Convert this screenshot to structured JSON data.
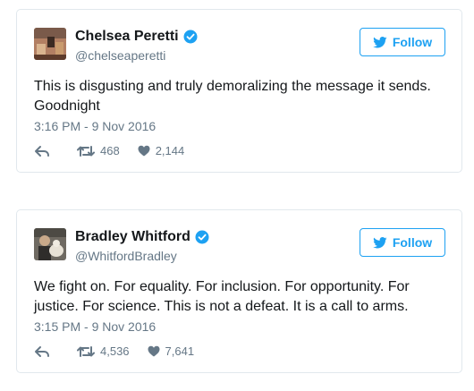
{
  "tweets": [
    {
      "name": "Chelsea Peretti",
      "handle": "@chelseaperetti",
      "follow_label": "Follow",
      "text": "This is disgusting and truly demoralizing the message it sends. Goodnight",
      "timestamp": "3:16 PM - 9 Nov 2016",
      "retweets": "468",
      "likes": "2,144"
    },
    {
      "name": "Bradley Whitford",
      "handle": "@WhitfordBradley",
      "follow_label": "Follow",
      "text": "We fight on. For equality. For inclusion. For opportunity. For justice. For science. This is not a defeat. It is a call to arms.",
      "timestamp": "3:15 PM - 9 Nov 2016",
      "retweets": "4,536",
      "likes": "7,641"
    }
  ],
  "colors": {
    "brand_blue": "#1da1f2",
    "text_primary": "#14171a",
    "text_secondary": "#657786",
    "border": "#e1e8ed"
  },
  "icons": {
    "verified": "verified-badge-icon",
    "bird": "twitter-bird-icon",
    "reply": "reply-icon",
    "retweet": "retweet-icon",
    "like": "heart-icon"
  }
}
